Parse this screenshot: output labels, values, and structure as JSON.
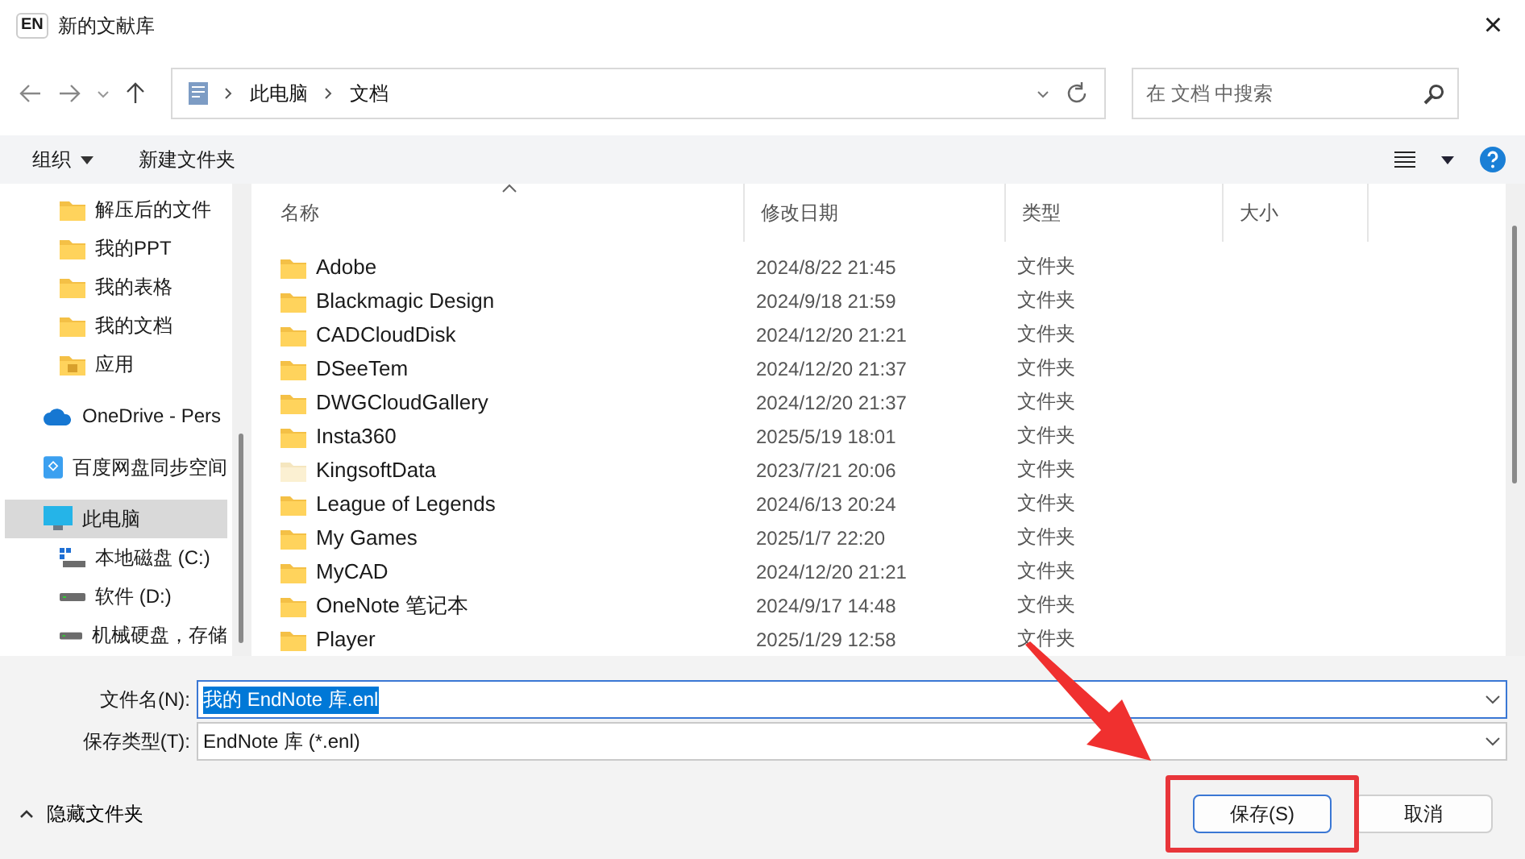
{
  "window": {
    "app_badge": "EN",
    "title": "新的文献库",
    "close": "×"
  },
  "address_bar": {
    "segments": [
      "此电脑",
      "文档"
    ]
  },
  "search": {
    "placeholder": "在 文档 中搜索"
  },
  "toolbar": {
    "organize": "组织",
    "new_folder": "新建文件夹"
  },
  "sidebar": {
    "items": [
      {
        "kind": "folder",
        "label": "解压后的文件",
        "selected": false
      },
      {
        "kind": "folder",
        "label": "我的PPT",
        "selected": false
      },
      {
        "kind": "folder",
        "label": "我的表格",
        "selected": false
      },
      {
        "kind": "folder",
        "label": "我的文档",
        "selected": false
      },
      {
        "kind": "app-folder",
        "label": "应用",
        "selected": false
      },
      {
        "kind": "cloud",
        "label": "OneDrive - Pers",
        "selected": false
      },
      {
        "kind": "sync",
        "label": "百度网盘同步空间",
        "selected": false
      },
      {
        "kind": "computer",
        "label": "此电脑",
        "selected": true,
        "children": [
          {
            "kind": "system-drive",
            "label": "本地磁盘 (C:)",
            "selected": false
          },
          {
            "kind": "drive",
            "label": "软件 (D:)",
            "selected": false
          },
          {
            "kind": "drive",
            "label": "机械硬盘，存储",
            "selected": false
          }
        ]
      }
    ]
  },
  "table": {
    "columns": [
      "名称",
      "修改日期",
      "类型",
      "大小"
    ],
    "rows": [
      {
        "name": "Adobe",
        "modified": "2024/8/22 21:45",
        "type": "文件夹",
        "faded": false
      },
      {
        "name": "Blackmagic Design",
        "modified": "2024/9/18 21:59",
        "type": "文件夹",
        "faded": false
      },
      {
        "name": "CADCloudDisk",
        "modified": "2024/12/20 21:21",
        "type": "文件夹",
        "faded": false
      },
      {
        "name": "DSeeTem",
        "modified": "2024/12/20 21:37",
        "type": "文件夹",
        "faded": false
      },
      {
        "name": "DWGCloudGallery",
        "modified": "2024/12/20 21:37",
        "type": "文件夹",
        "faded": false
      },
      {
        "name": "Insta360",
        "modified": "2025/5/19 18:01",
        "type": "文件夹",
        "faded": false
      },
      {
        "name": "KingsoftData",
        "modified": "2023/7/21 20:06",
        "type": "文件夹",
        "faded": true
      },
      {
        "name": "League of Legends",
        "modified": "2024/6/13 20:24",
        "type": "文件夹",
        "faded": false
      },
      {
        "name": "My Games",
        "modified": "2025/1/7 22:20",
        "type": "文件夹",
        "faded": false
      },
      {
        "name": "MyCAD",
        "modified": "2024/12/20 21:21",
        "type": "文件夹",
        "faded": false
      },
      {
        "name": "OneNote 笔记本",
        "modified": "2024/9/17 14:48",
        "type": "文件夹",
        "faded": false
      },
      {
        "name": "Player",
        "modified": "2025/1/29 12:58",
        "type": "文件夹",
        "faded": false
      }
    ]
  },
  "form": {
    "fields": [
      {
        "label": "文件名(N):",
        "value": "我的 EndNote 库.enl",
        "selected": true
      },
      {
        "label": "保存类型(T):",
        "value": "EndNote 库 (*.enl)",
        "selected": false
      }
    ]
  },
  "footer": {
    "hide_folders": "隐藏文件夹",
    "buttons": [
      {
        "label": "保存(S)",
        "primary": true,
        "highlighted": true
      },
      {
        "label": "取消",
        "primary": false,
        "highlighted": false
      }
    ]
  },
  "annotation": {
    "arrow": true
  }
}
